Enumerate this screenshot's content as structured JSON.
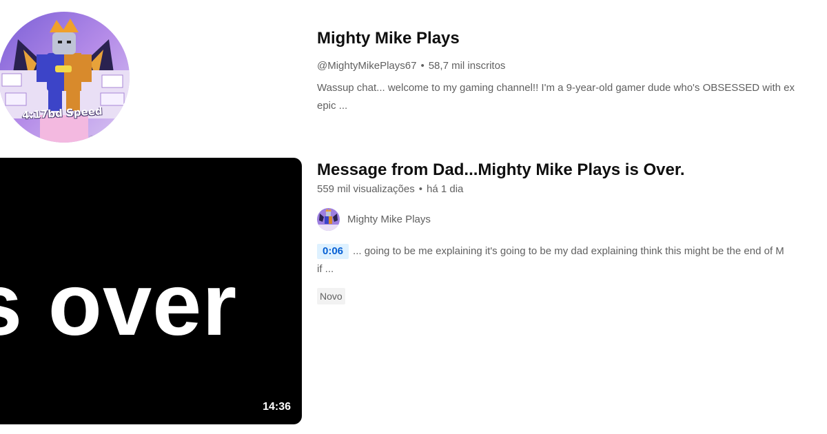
{
  "channel": {
    "avatar_text": "4:17bd Speed",
    "avatar_small_text": "12o",
    "name": "Mighty Mike Plays",
    "handle": "@MightyMikePlays67",
    "separator": "•",
    "subscribers": "58,7 mil inscritos",
    "description_line1": "Wassup chat... welcome to my gaming channel!! I'm a 9-year-old gamer dude who's OBSESSED with ex",
    "description_line2": "epic ..."
  },
  "video": {
    "thumbnail_text": "s over",
    "duration": "14:36",
    "title": "Message from Dad...Mighty Mike Plays is Over.",
    "views": "559 mil visualizações",
    "separator": "•",
    "age": "há 1 dia",
    "channel_name": "Mighty Mike Plays",
    "timestamp": "0:06",
    "snippet_line1": "... going to be me explaining it's going to be my dad explaining think this might be the end of M",
    "snippet_line2": "if ...",
    "badge": "Novo"
  }
}
